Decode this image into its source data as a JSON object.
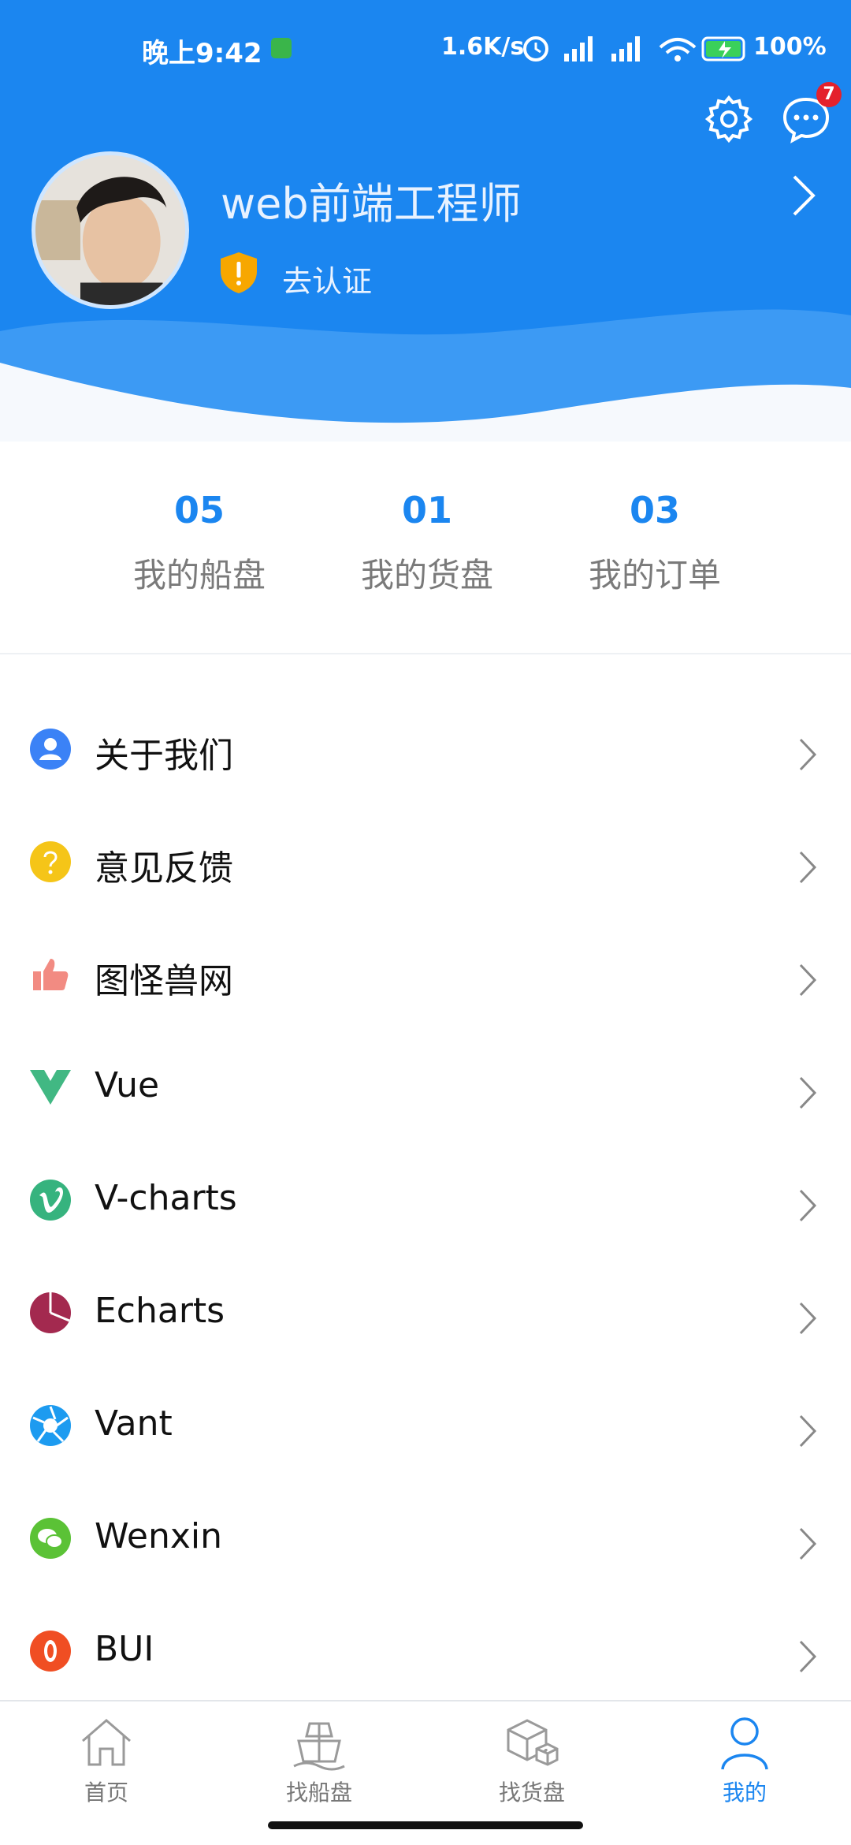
{
  "status_bar": {
    "time": "晚上9:42",
    "speed": "1.6K/s",
    "battery": "100%"
  },
  "header": {
    "username": "web前端工程师",
    "verify_label": "去认证",
    "message_badge": "7",
    "settings_icon": "gear-icon",
    "message_icon": "chat-bubble-icon"
  },
  "stats": [
    {
      "value": "05",
      "label": "我的船盘"
    },
    {
      "value": "01",
      "label": "我的货盘"
    },
    {
      "value": "03",
      "label": "我的订单"
    }
  ],
  "menu": [
    {
      "label": "关于我们",
      "icon": "person-icon",
      "color": "#3b82f6"
    },
    {
      "label": "意见反馈",
      "icon": "question-icon",
      "color": "#f5c518"
    },
    {
      "label": "图怪兽网",
      "icon": "thumbs-up-icon",
      "color": "#f28b82"
    },
    {
      "label": "Vue",
      "icon": "vue-icon",
      "color": "#41b883"
    },
    {
      "label": "V-charts",
      "icon": "vimeo-icon",
      "color": "#36b37e"
    },
    {
      "label": "Echarts",
      "icon": "pie-icon",
      "color": "#a3294f"
    },
    {
      "label": "Vant",
      "icon": "aperture-icon",
      "color": "#1d9bf0"
    },
    {
      "label": "Wenxin",
      "icon": "wechat-icon",
      "color": "#5bc236"
    },
    {
      "label": "BUI",
      "icon": "bui-icon",
      "color": "#f04e23"
    }
  ],
  "tabbar": [
    {
      "label": "首页",
      "icon": "home-icon"
    },
    {
      "label": "找船盘",
      "icon": "ship-icon"
    },
    {
      "label": "找货盘",
      "icon": "box-icon"
    },
    {
      "label": "我的",
      "icon": "user-icon",
      "active": true
    }
  ],
  "colors": {
    "primary": "#1b86f0",
    "badge": "#e4212b"
  }
}
